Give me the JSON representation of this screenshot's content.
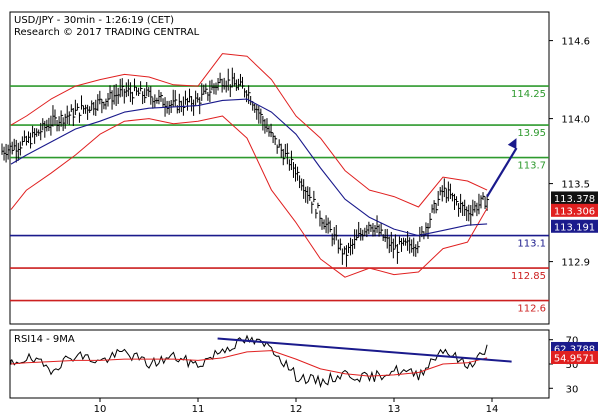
{
  "header": {
    "instrument": "USD/JPY - 30min - 1:26:19 (CET)",
    "research": "Research © 2017 TRADING CENTRAL"
  },
  "colors": {
    "resistance": "#2e9a2e",
    "pivot": "#1a1a8c",
    "support": "#cc2020",
    "bollinger": "#e02020",
    "moving_average": "#1a1a8c",
    "rsi_ma": "#e02020",
    "forecast_arrow": "#1a1a8c",
    "price_tag": "#111111"
  },
  "chart_data": [
    {
      "type": "line",
      "panel": "price",
      "ylim": [
        112.42,
        114.82
      ],
      "y_ticks": [
        "114.6",
        "114.0",
        "113.5",
        "112.9"
      ],
      "x_ticks": [
        "10",
        "11",
        "12",
        "13",
        "14"
      ],
      "levels": [
        {
          "value": 114.25,
          "label": "114.25",
          "kind": "resistance"
        },
        {
          "value": 113.95,
          "label": "13.95",
          "kind": "resistance"
        },
        {
          "value": 113.7,
          "label": "113.7",
          "kind": "resistance"
        },
        {
          "value": 113.1,
          "label": "113.1",
          "kind": "pivot"
        },
        {
          "value": 112.85,
          "label": "112.85",
          "kind": "support"
        },
        {
          "value": 112.6,
          "label": "112.6",
          "kind": "support"
        }
      ],
      "tags": [
        {
          "value": 113.378,
          "label": "113.378",
          "kind": "price"
        },
        {
          "value": 113.306,
          "label": "113.306",
          "kind": "bollinger"
        },
        {
          "value": 113.191,
          "label": "113.191",
          "kind": "moving_average"
        }
      ],
      "x": [
        9.0,
        9.25,
        9.5,
        9.75,
        10.0,
        10.25,
        10.5,
        10.75,
        11.0,
        11.25,
        11.5,
        11.75,
        12.0,
        12.25,
        12.5,
        12.75,
        13.0,
        13.25,
        13.5,
        13.75,
        13.95
      ],
      "close": [
        113.75,
        113.82,
        113.97,
        114.05,
        114.13,
        114.21,
        114.18,
        114.1,
        114.14,
        114.3,
        114.22,
        113.86,
        113.6,
        113.25,
        112.95,
        113.2,
        113.0,
        113.05,
        113.45,
        113.28,
        113.38
      ],
      "moving_average": [
        113.65,
        113.72,
        113.82,
        113.92,
        113.98,
        114.05,
        114.08,
        114.09,
        114.1,
        114.14,
        114.15,
        114.05,
        113.88,
        113.62,
        113.38,
        113.24,
        113.15,
        113.1,
        113.14,
        113.18,
        113.19
      ],
      "bollinger_upper": [
        113.95,
        114.02,
        114.15,
        114.25,
        114.3,
        114.34,
        114.32,
        114.26,
        114.25,
        114.5,
        114.48,
        114.3,
        114.02,
        113.85,
        113.6,
        113.45,
        113.4,
        113.32,
        113.55,
        113.52,
        113.45
      ],
      "bollinger_lower": [
        113.3,
        113.45,
        113.58,
        113.72,
        113.88,
        113.98,
        114.0,
        113.96,
        113.98,
        114.02,
        113.85,
        113.45,
        113.2,
        112.92,
        112.78,
        112.85,
        112.8,
        112.82,
        113.0,
        113.05,
        113.31
      ],
      "forecast": {
        "from": [
          13.95,
          113.4
        ],
        "to": [
          14.25,
          113.85
        ]
      }
    },
    {
      "type": "line",
      "panel": "rsi",
      "title": "RSI14 - 9MA",
      "ylim": [
        22,
        78
      ],
      "y_ticks": [
        "70",
        "50",
        "30"
      ],
      "x": [
        9.0,
        9.25,
        9.5,
        9.75,
        10.0,
        10.25,
        10.5,
        10.75,
        11.0,
        11.25,
        11.5,
        11.75,
        12.0,
        12.25,
        12.5,
        12.75,
        13.0,
        13.25,
        13.5,
        13.75,
        13.95
      ],
      "rsi": [
        48,
        55,
        46,
        58,
        52,
        60,
        50,
        56,
        49,
        62,
        70,
        64,
        40,
        35,
        42,
        38,
        45,
        41,
        63,
        48,
        62.4
      ],
      "rsi_ma": [
        50,
        51,
        52,
        53,
        53,
        54,
        54,
        54,
        53,
        55,
        60,
        61,
        54,
        46,
        42,
        40,
        41,
        43,
        50,
        51,
        55.0
      ],
      "trendline": {
        "from": [
          11.2,
          71
        ],
        "to": [
          14.2,
          52
        ]
      },
      "tags": [
        {
          "value": 62.3788,
          "label": "62.3788",
          "kind": "rsi"
        },
        {
          "value": 54.9571,
          "label": "54.9571",
          "kind": "rsi_ma"
        }
      ]
    }
  ]
}
